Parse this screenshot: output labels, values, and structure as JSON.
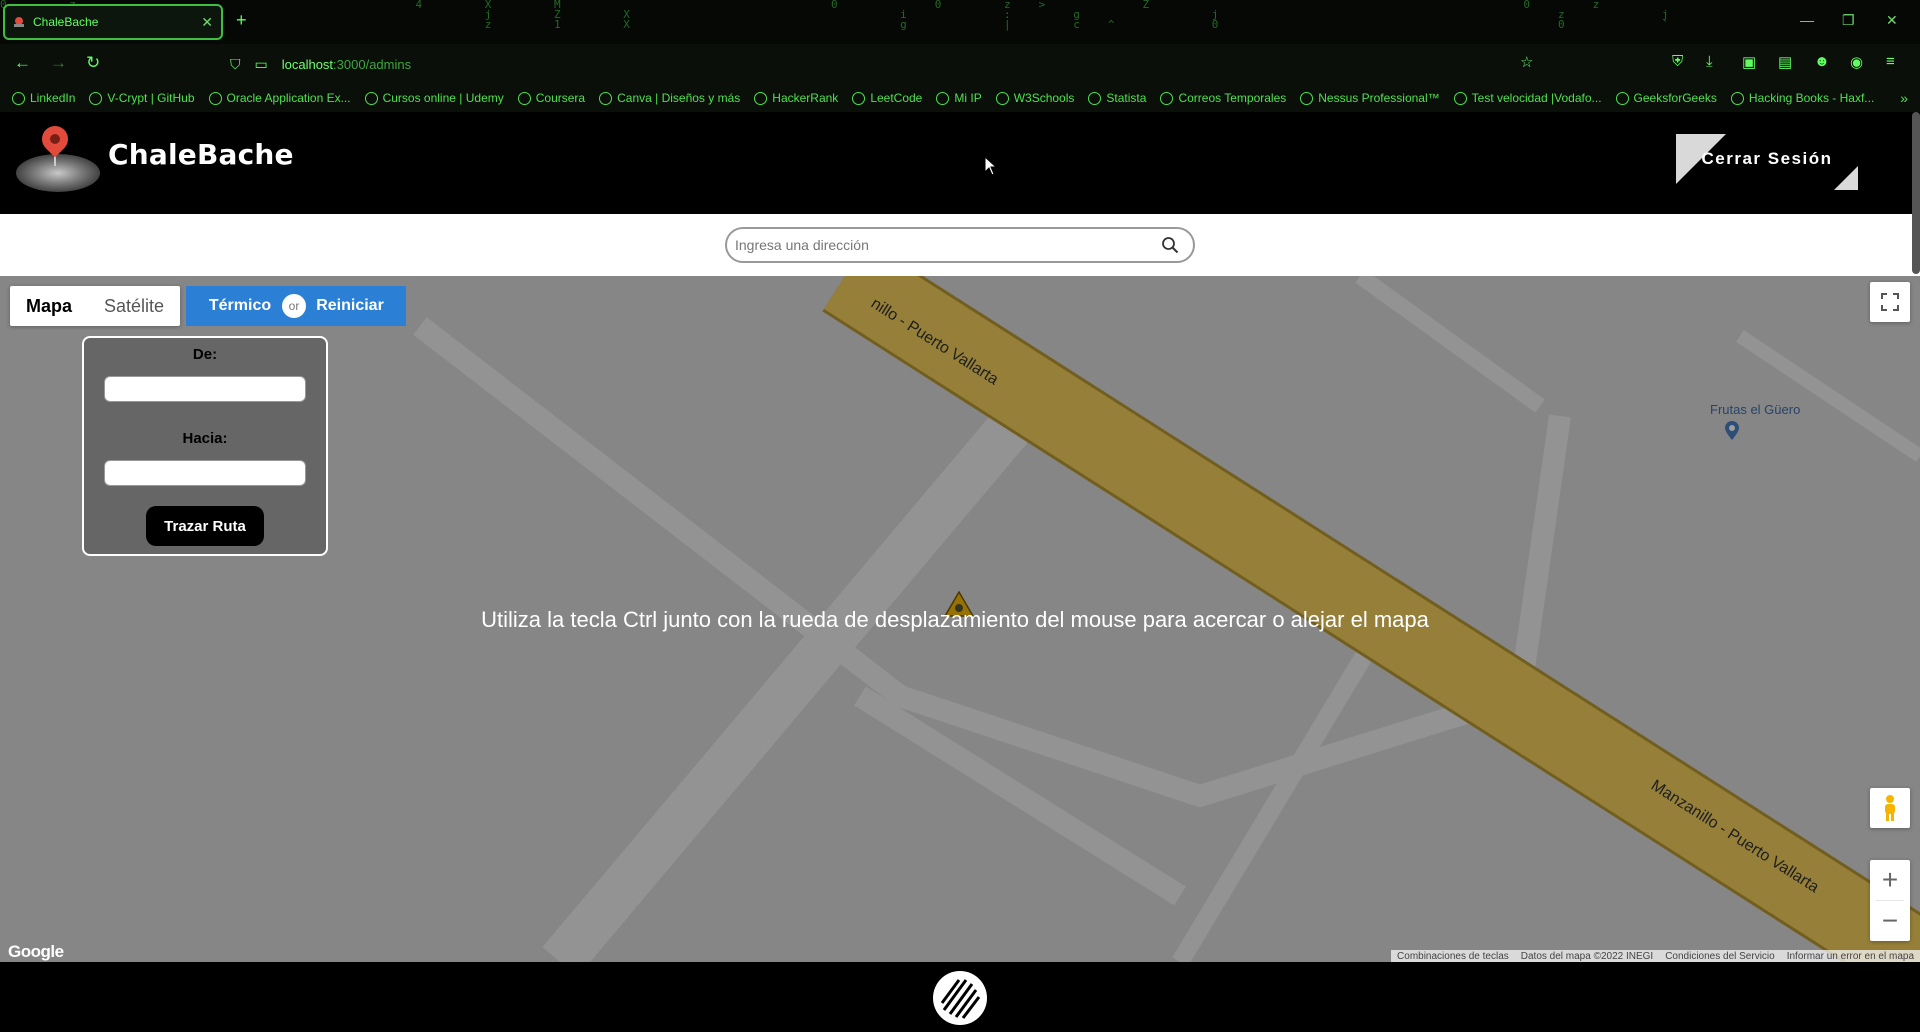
{
  "browser": {
    "tab_title": "ChaleBache",
    "tab_close": "✕",
    "new_tab": "+",
    "url_host": "localhost",
    "url_rest": ":3000/admins",
    "bookmarks": [
      {
        "label": "LinkedIn",
        "icon": "linkedin-icon"
      },
      {
        "label": "V-Crypt | GitHub",
        "icon": "github-icon"
      },
      {
        "label": "Oracle Application Ex...",
        "icon": "oracle-icon"
      },
      {
        "label": "Cursos online | Udemy",
        "icon": "udemy-icon"
      },
      {
        "label": "Coursera",
        "icon": "globe-icon"
      },
      {
        "label": "Canva | Diseños y más",
        "icon": "canva-icon"
      },
      {
        "label": "HackerRank",
        "icon": "globe-icon"
      },
      {
        "label": "LeetCode",
        "icon": "globe-icon"
      },
      {
        "label": "Mi IP",
        "icon": "globe-icon"
      },
      {
        "label": "W3Schools",
        "icon": "w3schools-icon"
      },
      {
        "label": "Statista",
        "icon": "statista-icon"
      },
      {
        "label": "Correos Temporales",
        "icon": "globe-icon"
      },
      {
        "label": "Nessus Professional™",
        "icon": "globe-icon"
      },
      {
        "label": "Test velocidad |Vodafo...",
        "icon": "vodafone-icon"
      },
      {
        "label": "GeeksforGeeks",
        "icon": "globe-icon"
      },
      {
        "label": "Hacking Books - Haxf...",
        "icon": "globe-icon"
      }
    ],
    "bookmarks_overflow": "»",
    "theme_color": "#4fe04f"
  },
  "header": {
    "app_title": "ChaleBache",
    "logout_label": "Cerrar Sesión"
  },
  "search": {
    "placeholder": "Ingresa una dirección",
    "value": ""
  },
  "map": {
    "map_type_options": [
      "Mapa",
      "Satélite"
    ],
    "map_type_selected": "Mapa",
    "termico_label": "Térmico",
    "or_label": "or",
    "reiniciar_label": "Reiniciar",
    "button_color": "#2b7fd4",
    "route": {
      "from_label": "De:",
      "to_label": "Hacia:",
      "from_value": "",
      "to_value": "",
      "button_label": "Trazar Ruta"
    },
    "hint": "Utiliza la tecla Ctrl junto con la rueda de desplazamiento del mouse para acercar o alejar el mapa",
    "road_label_1": "nillo - Puerto Vallarta",
    "road_label_2": "Manzanillo - Puerto Vallarta",
    "poi_label": "Frutas el Güero",
    "google_logo": "Google",
    "attribution": [
      "Combinaciones de teclas",
      "Datos del mapa ©2022 INEGI",
      "Condiciones del Servicio",
      "Informar un error en el mapa"
    ],
    "zoom_in": "+",
    "zoom_out": "−"
  }
}
